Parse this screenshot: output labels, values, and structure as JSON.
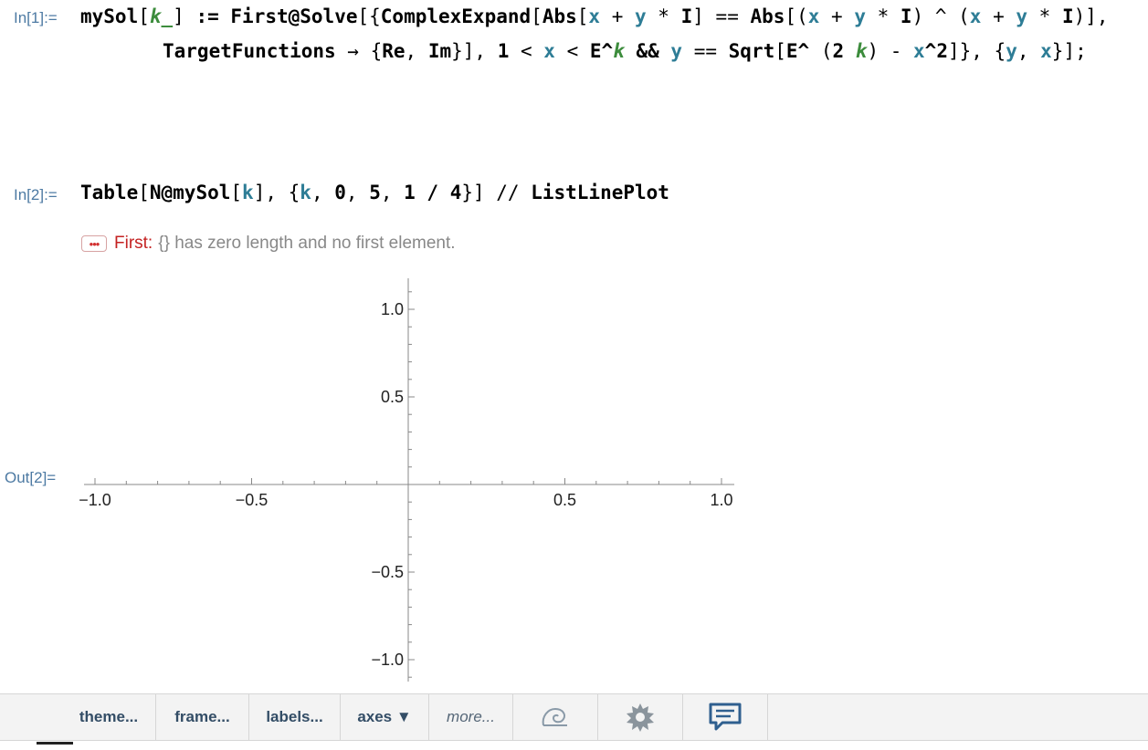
{
  "cells": {
    "in1": {
      "label": "In[1]:=",
      "line1": [
        {
          "t": "mySol"
        },
        {
          "t": "[",
          "op": true
        },
        {
          "t": "k_",
          "c": "p"
        },
        {
          "t": "]",
          "op": true
        },
        {
          "t": " := "
        },
        {
          "t": "First@Solve"
        },
        {
          "t": "[{",
          "op": true
        },
        {
          "t": "ComplexExpand"
        },
        {
          "t": "[",
          "op": true
        },
        {
          "t": "Abs"
        },
        {
          "t": "[",
          "op": true
        },
        {
          "t": "x",
          "c": "v"
        },
        {
          "t": " + ",
          "op": true
        },
        {
          "t": "y",
          "c": "v"
        },
        {
          "t": " * ",
          "op": true
        },
        {
          "t": "I"
        },
        {
          "t": "]",
          "op": true
        },
        {
          "t": " == ",
          "op": true
        },
        {
          "t": "Abs"
        },
        {
          "t": "[(",
          "op": true
        },
        {
          "t": "x",
          "c": "v"
        },
        {
          "t": " + ",
          "op": true
        },
        {
          "t": "y",
          "c": "v"
        },
        {
          "t": " * ",
          "op": true
        },
        {
          "t": "I"
        },
        {
          "t": ") ^ (",
          "op": true
        },
        {
          "t": "x",
          "c": "v"
        },
        {
          "t": " + ",
          "op": true
        },
        {
          "t": "y",
          "c": "v"
        },
        {
          "t": " * ",
          "op": true
        },
        {
          "t": "I"
        },
        {
          "t": ")],",
          "op": true
        }
      ],
      "line2": [
        {
          "t": "TargetFunctions"
        },
        {
          "t": " → {",
          "op": true
        },
        {
          "t": "Re"
        },
        {
          "t": ", ",
          "op": true
        },
        {
          "t": "Im"
        },
        {
          "t": "}], ",
          "op": true
        },
        {
          "t": "1"
        },
        {
          "t": " < ",
          "op": true
        },
        {
          "t": "x",
          "c": "v"
        },
        {
          "t": " < ",
          "op": true
        },
        {
          "t": "E^"
        },
        {
          "t": "k",
          "c": "p"
        },
        {
          "t": " && "
        },
        {
          "t": "y",
          "c": "v"
        },
        {
          "t": " == ",
          "op": true
        },
        {
          "t": "Sqrt"
        },
        {
          "t": "[",
          "op": true
        },
        {
          "t": "E^"
        },
        {
          "t": " (",
          "op": true
        },
        {
          "t": "2 "
        },
        {
          "t": "k",
          "c": "p"
        },
        {
          "t": ") - ",
          "op": true
        },
        {
          "t": "x",
          "c": "v"
        },
        {
          "t": "^2"
        },
        {
          "t": "]}, {",
          "op": true
        },
        {
          "t": "y",
          "c": "v"
        },
        {
          "t": ", ",
          "op": true
        },
        {
          "t": "x",
          "c": "v"
        },
        {
          "t": "}];",
          "op": true
        }
      ]
    },
    "in2": {
      "label": "In[2]:=",
      "line1": [
        {
          "t": "Table"
        },
        {
          "t": "[",
          "op": true
        },
        {
          "t": "N@mySol"
        },
        {
          "t": "[",
          "op": true
        },
        {
          "t": "k",
          "c": "v"
        },
        {
          "t": "], {",
          "op": true
        },
        {
          "t": "k",
          "c": "v"
        },
        {
          "t": ", ",
          "op": true
        },
        {
          "t": "0"
        },
        {
          "t": ", ",
          "op": true
        },
        {
          "t": "5"
        },
        {
          "t": ", ",
          "op": true
        },
        {
          "t": "1 / 4"
        },
        {
          "t": "}] // ",
          "op": true
        },
        {
          "t": "ListLinePlot"
        }
      ]
    },
    "message": {
      "icon": "•••",
      "symbol": "First:",
      "text": "{} has zero length and no first element."
    },
    "out2": {
      "label": "Out[2]="
    }
  },
  "chart_data": {
    "type": "line",
    "series": [],
    "xlim": [
      -1.0,
      1.0
    ],
    "ylim": [
      -1.0,
      1.0
    ],
    "xticks": [
      -1.0,
      -0.5,
      0.5,
      1.0
    ],
    "yticks": [
      1.0,
      0.5,
      -0.5,
      -1.0
    ],
    "xtick_labels": [
      "−1.0",
      "−0.5",
      "0.5",
      "1.0"
    ],
    "ytick_labels": [
      "1.0",
      "0.5",
      "−0.5",
      "−1.0"
    ],
    "grid": false,
    "axis_color": "#888888"
  },
  "toolbar": {
    "buttons": [
      {
        "name": "theme-button",
        "label": "theme..."
      },
      {
        "name": "frame-button",
        "label": "frame..."
      },
      {
        "name": "labels-button",
        "label": "labels..."
      },
      {
        "name": "axes-button",
        "label": "axes ▼"
      },
      {
        "name": "more-button",
        "label": "more..."
      }
    ],
    "icons": [
      {
        "name": "swirl-icon"
      },
      {
        "name": "gear-icon"
      },
      {
        "name": "feedback-chat-icon"
      }
    ]
  }
}
